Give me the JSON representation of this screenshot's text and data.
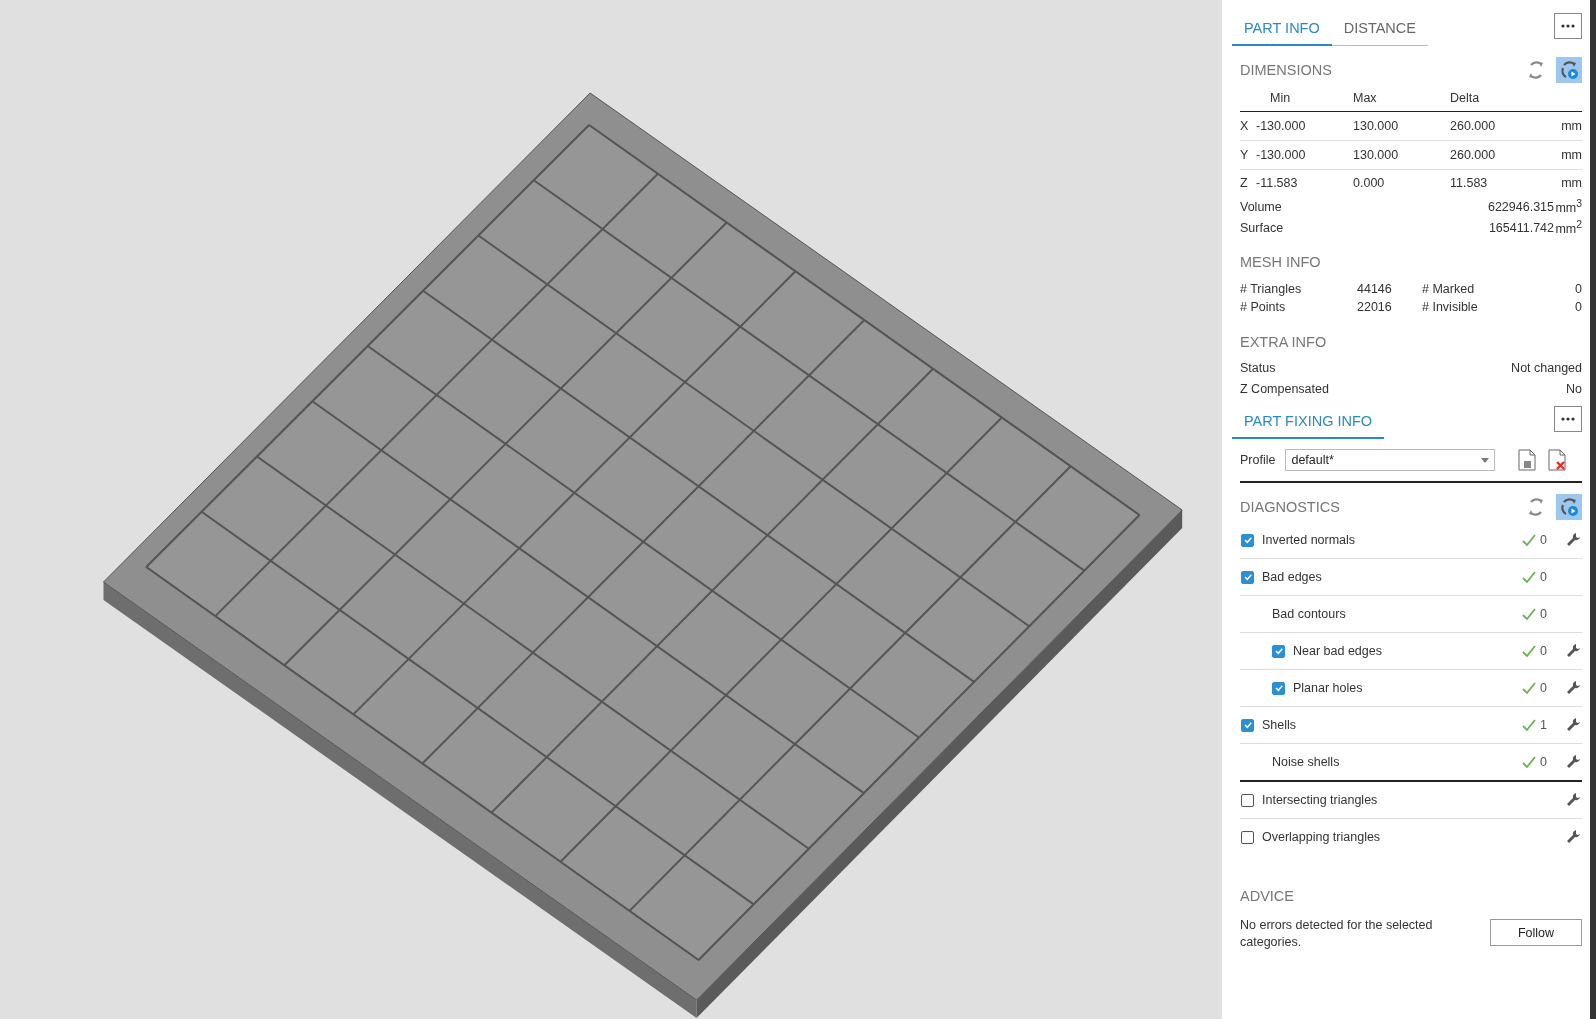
{
  "tabs": [
    {
      "label": "PART INFO",
      "selected": true
    },
    {
      "label": "DISTANCE",
      "selected": false
    }
  ],
  "dimensions": {
    "title": "DIMENSIONS",
    "auto_update": true,
    "columns": [
      "Min",
      "Max",
      "Delta"
    ],
    "rows": [
      {
        "axis": "X",
        "min": "-130.000",
        "max": "130.000",
        "delta": "260.000",
        "unit": "mm"
      },
      {
        "axis": "Y",
        "min": "-130.000",
        "max": "130.000",
        "delta": "260.000",
        "unit": "mm"
      },
      {
        "axis": "Z",
        "min": "-11.583",
        "max": "0.000",
        "delta": "11.583",
        "unit": "mm"
      }
    ],
    "totals": [
      {
        "label": "Volume",
        "value": "622946.315",
        "unit": "mm$^{3}$"
      },
      {
        "label": "Surface",
        "value": "165411.742",
        "unit": "mm$^{2}$"
      }
    ]
  },
  "mesh_info": {
    "title": "MESH INFO",
    "stats": [
      {
        "label": "# Triangles",
        "value": "44146"
      },
      {
        "label": "# Marked",
        "value": "0"
      },
      {
        "label": "# Points",
        "value": "22016"
      },
      {
        "label": "# Invisible",
        "value": "0"
      }
    ]
  },
  "extra_info": {
    "title": "EXTRA INFO",
    "rows": [
      {
        "label": "Status",
        "value": "Not changed"
      },
      {
        "label": "Z Compensated",
        "value": "No"
      }
    ]
  },
  "fixing_tab": {
    "label": "PART FIXING INFO",
    "selected": true
  },
  "profile": {
    "label": "Profile",
    "value": "default*"
  },
  "diagnostics": {
    "title": "DIAGNOSTICS",
    "auto_update": true,
    "groups": [
      [
        {
          "label": "Inverted normals",
          "kind": "check",
          "checked": true,
          "ok": true,
          "count": "0",
          "fixable": true
        },
        {
          "label": "Bad edges",
          "kind": "check",
          "checked": true,
          "ok": true,
          "count": "0",
          "fixable": false,
          "children": [
            {
              "label": "Bad contours",
              "kind": "plain",
              "ok": true,
              "count": "0",
              "fixable": false
            },
            {
              "label": "Near bad edges",
              "kind": "check",
              "checked": true,
              "ok": true,
              "count": "0",
              "fixable": true
            },
            {
              "label": "Planar holes",
              "kind": "check",
              "checked": true,
              "ok": true,
              "count": "0",
              "fixable": true
            }
          ]
        },
        {
          "label": "Shells",
          "kind": "check",
          "checked": true,
          "ok": true,
          "count": "1",
          "fixable": true,
          "children": [
            {
              "label": "Noise shells",
              "kind": "plain",
              "ok": true,
              "count": "0",
              "fixable": true
            }
          ]
        }
      ],
      [
        {
          "label": "Intersecting triangles",
          "kind": "check",
          "checked": false,
          "ok": false,
          "fixable": true
        },
        {
          "label": "Overlapping triangles",
          "kind": "check",
          "checked": false,
          "ok": false,
          "fixable": true
        }
      ]
    ]
  },
  "advice": {
    "title": "ADVICE",
    "text": "No errors detected for the selected categories.",
    "button": "Follow"
  }
}
